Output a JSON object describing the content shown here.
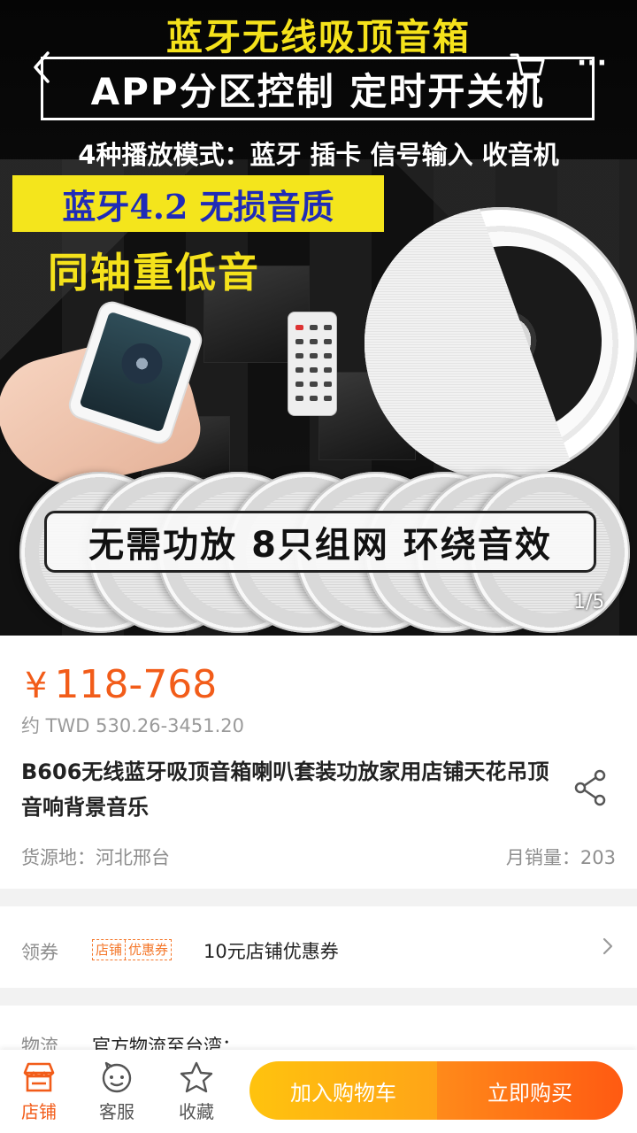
{
  "hero": {
    "headline": "蓝牙无线吸顶音箱",
    "app_line": "APP分区控制  定时开关机",
    "modes_line": "4种播放模式：蓝牙 插卡 信号输入 收音机",
    "bt_tag": "蓝牙4.2 无损音质",
    "bass_line": "同轴重低音",
    "banner": "无需功放 8只组网 环绕音效",
    "pager": "1/5"
  },
  "product": {
    "price": "118-768",
    "currency_symbol": "¥",
    "converted_price": "约 TWD 530.26-3451.20",
    "title": "B606无线蓝牙吸顶音箱喇叭套装功放家用店铺天花吊顶音响背景音乐",
    "origin": "货源地：河北邢台",
    "monthly_sales": "月销量：203"
  },
  "coupon": {
    "label": "领券",
    "tag_left": "店铺",
    "tag_right": "优惠券",
    "text": "10元店铺优惠券"
  },
  "logistics": {
    "label": "物流",
    "text": "官方物流至台湾："
  },
  "bottom_bar": {
    "store_label": "店铺",
    "service_label": "客服",
    "favorite_label": "收藏",
    "add_to_cart_label": "加入购物车",
    "buy_now_label": "立即购买"
  },
  "colors": {
    "accent": "#f25c19",
    "cart_button": "#ffb414",
    "buy_button": "#ff6a14",
    "hero_yellow": "#f5e21b"
  },
  "icons": [
    "back-icon",
    "cart-icon",
    "more-icon",
    "share-icon",
    "chevron-right-icon",
    "store-icon",
    "service-icon",
    "star-icon"
  ]
}
